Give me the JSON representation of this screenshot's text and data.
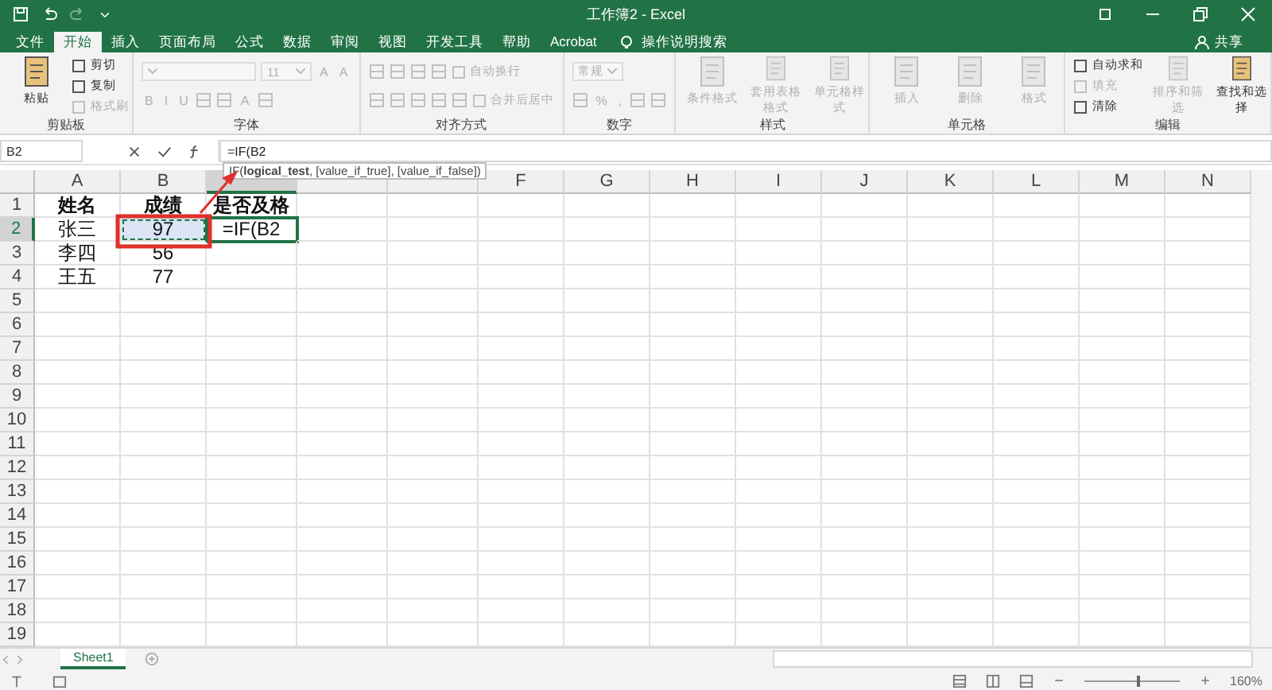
{
  "window": {
    "title": "工作簿2  -  Excel"
  },
  "tabs": [
    {
      "label": "文件",
      "selected": false
    },
    {
      "label": "开始",
      "selected": true
    },
    {
      "label": "插入",
      "selected": false
    },
    {
      "label": "页面布局",
      "selected": false
    },
    {
      "label": "公式",
      "selected": false
    },
    {
      "label": "数据",
      "selected": false
    },
    {
      "label": "审阅",
      "selected": false
    },
    {
      "label": "视图",
      "selected": false
    },
    {
      "label": "开发工具",
      "selected": false
    },
    {
      "label": "帮助",
      "selected": false
    },
    {
      "label": "Acrobat",
      "selected": false
    }
  ],
  "tell_me": "操作说明搜索",
  "share": "共享",
  "ribbon": {
    "groups": [
      {
        "label": "剪贴板",
        "kind": "columns",
        "items": [
          {
            "kind": "large",
            "label": "粘贴",
            "disabled": false
          },
          {
            "kind": "small",
            "label": "剪切",
            "disabled": false
          },
          {
            "kind": "small",
            "label": "复制",
            "disabled": false
          },
          {
            "kind": "small",
            "label": "格式刷",
            "disabled": true
          }
        ]
      },
      {
        "label": "字体",
        "kind": "rows",
        "rows": [
          [
            {
              "kind": "combo",
              "disabled": true
            },
            {
              "kind": "combo",
              "value": "11",
              "disabled": true
            },
            {
              "kind": "tool",
              "label": "A",
              "disabled": true
            },
            {
              "kind": "tool",
              "label": "A",
              "disabled": true
            }
          ],
          [
            {
              "kind": "tool",
              "label": "B",
              "disabled": true
            },
            {
              "kind": "tool",
              "label": "I",
              "disabled": true
            },
            {
              "kind": "tool",
              "label": "U",
              "disabled": true
            },
            {
              "kind": "icon",
              "disabled": true
            },
            {
              "kind": "icon",
              "disabled": true
            },
            {
              "kind": "tool",
              "label": "A",
              "disabled": true
            },
            {
              "kind": "icon",
              "disabled": true
            }
          ]
        ]
      },
      {
        "label": "对齐方式",
        "kind": "rows",
        "rows": [
          [
            {
              "kind": "icon",
              "disabled": true
            },
            {
              "kind": "icon",
              "disabled": true
            },
            {
              "kind": "icon",
              "disabled": true
            },
            {
              "kind": "icon",
              "disabled": true
            },
            {
              "kind": "small",
              "label": "自动换行",
              "disabled": true
            }
          ],
          [
            {
              "kind": "icon",
              "disabled": true
            },
            {
              "kind": "icon",
              "disabled": true
            },
            {
              "kind": "icon",
              "disabled": true
            },
            {
              "kind": "icon",
              "disabled": true
            },
            {
              "kind": "icon",
              "disabled": true
            },
            {
              "kind": "small",
              "label": "合并后居中",
              "disabled": true
            }
          ]
        ]
      },
      {
        "label": "数字",
        "kind": "rows",
        "rows": [
          [
            {
              "kind": "combo",
              "value": "常规",
              "disabled": true
            }
          ],
          [
            {
              "kind": "icon",
              "disabled": true
            },
            {
              "kind": "tool",
              "label": "%",
              "disabled": true
            },
            {
              "kind": "tool",
              "label": ",",
              "disabled": true
            },
            {
              "kind": "icon",
              "disabled": true
            },
            {
              "kind": "icon",
              "disabled": true
            }
          ]
        ]
      },
      {
        "label": "样式",
        "kind": "columns",
        "items": [
          {
            "kind": "large",
            "label": "条件格式",
            "disabled": true
          },
          {
            "kind": "large",
            "label": "套用表格格式",
            "disabled": true
          },
          {
            "kind": "large",
            "label": "单元格样式",
            "disabled": true
          }
        ]
      },
      {
        "label": "单元格",
        "kind": "columns",
        "items": [
          {
            "kind": "large",
            "label": "插入",
            "disabled": true
          },
          {
            "kind": "large",
            "label": "删除",
            "disabled": true
          },
          {
            "kind": "large",
            "label": "格式",
            "disabled": true
          }
        ]
      },
      {
        "label": "编辑",
        "kind": "columns",
        "items": [
          {
            "kind": "small",
            "label": "自动求和",
            "disabled": false
          },
          {
            "kind": "small",
            "label": "填充",
            "disabled": true
          },
          {
            "kind": "small",
            "label": "清除",
            "disabled": false
          },
          {
            "kind": "large",
            "label": "排序和筛选",
            "disabled": true
          },
          {
            "kind": "large",
            "label": "查找和选择",
            "disabled": false
          }
        ]
      }
    ]
  },
  "formula_bar": {
    "name_box": "B2",
    "formula": "=IF(B2",
    "tooltip": "IF(**logical_test**, [value_if_true], [value_if_false])"
  },
  "sheet": {
    "columns": [
      {
        "label": "A",
        "selected": false
      },
      {
        "label": "B",
        "selected": false
      },
      {
        "selected": true
      },
      {
        "selected": false
      },
      {
        "selected": false
      },
      {
        "label": "F",
        "selected": false
      },
      {
        "label": "G",
        "selected": false
      },
      {
        "label": "H",
        "selected": false
      },
      {
        "label": "I",
        "selected": false
      },
      {
        "label": "J",
        "selected": false
      },
      {
        "label": "K",
        "selected": false
      },
      {
        "label": "L",
        "selected": false
      },
      {
        "label": "M",
        "selected": false
      },
      {
        "label": "N",
        "selected": false
      }
    ],
    "rows": [
      {
        "number": "1",
        "selected": false,
        "bold": true,
        "cells": [
          {
            "text": "姓名",
            "copied": false,
            "editing": false
          },
          {
            "text": "成绩",
            "copied": false,
            "editing": false
          },
          {
            "text": "是否及格",
            "copied": false,
            "editing": false
          }
        ]
      },
      {
        "number": "2",
        "selected": true,
        "bold": false,
        "cells": [
          {
            "text": "张三",
            "copied": false,
            "editing": false
          },
          {
            "text": "97",
            "copied": true,
            "editing": false
          },
          {
            "text": "=IF(B2",
            "copied": false,
            "editing": true
          }
        ]
      },
      {
        "number": "3",
        "selected": false,
        "bold": false,
        "cells": [
          {
            "text": "李四",
            "copied": false,
            "editing": false
          },
          {
            "text": "56",
            "copied": false,
            "editing": false
          }
        ]
      },
      {
        "number": "4",
        "selected": false,
        "bold": false,
        "cells": [
          {
            "text": "王五",
            "copied": false,
            "editing": false
          },
          {
            "text": "77",
            "copied": false,
            "editing": false
          }
        ]
      },
      {
        "number": "5",
        "selected": false
      },
      {
        "number": "6",
        "selected": false
      },
      {
        "number": "7",
        "selected": false
      },
      {
        "number": "8",
        "selected": false
      },
      {
        "number": "9",
        "selected": false
      },
      {
        "number": "10",
        "selected": false
      },
      {
        "number": "11",
        "selected": false
      },
      {
        "number": "12",
        "selected": false
      },
      {
        "number": "13",
        "selected": false
      },
      {
        "number": "14",
        "selected": false
      },
      {
        "number": "15",
        "selected": false
      },
      {
        "number": "16",
        "selected": false
      },
      {
        "number": "17",
        "selected": false
      },
      {
        "number": "18",
        "selected": false
      },
      {
        "number": "19",
        "selected": false
      }
    ]
  },
  "sheet_tabs": [
    {
      "label": "Sheet1",
      "selected": true
    }
  ],
  "status_bar": {
    "zoom": "160%",
    "level": 0.55
  }
}
